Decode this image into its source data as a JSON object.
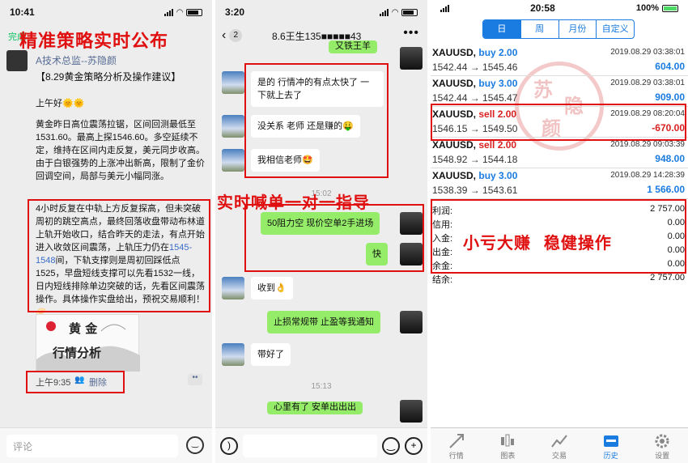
{
  "panel1": {
    "status_time": "10:41",
    "top_left": "完成",
    "overlay_title": "精准策略实时公布",
    "author": "A技术总监--苏隐颜",
    "subtitle": "【8.29黄金策略分析及操作建议】",
    "greeting": "上午好🌞🌞",
    "para1": "黄金昨日高位震荡拉锯，区间回测最低至1531.60。最高上探1546.60。多空延续不定，维持在区间内走反复，美元同步收高。由于白银强势的上涨冲出新高，限制了金价回调空间，局部与美元小幅同涨。",
    "para2_a": "4小时反复在中轨上方反复探高，但未突破周初的跳空高点，最终回落收盘带动布林道上轨开始收口，结合昨天的走法，有点开始进入收敛区间震荡，上轨压力仍在",
    "para2_range": "1545-1548",
    "para2_b": "间，下轨支撑则是周初回踩低点1525，早盘短线支撑可以先看1532一线，日内短线排除单边突破的话，先看区间震荡操作。具体操作实盘给出，预祝交易顺利！🥟",
    "poster_line1": "黄 金",
    "poster_line2": "行情分析",
    "time": "上午9:35",
    "delete": "删除",
    "comment_placeholder": "评论"
  },
  "panel2": {
    "status_time": "3:20",
    "back_count": "2",
    "chat_title": "8.6王生135■■■■■43",
    "overlay_mid": "实时喊单一对一指导",
    "messages": {
      "m0": "又铁王羊",
      "m1": "是的 行情冲的有点太快了 一下就上去了",
      "m2": "没关系 老师 还是赚的🤑",
      "m3": "我相信老师🤩",
      "ts1": "15:02",
      "m4": "50阻力空 现价空单2手进场",
      "m5": "快",
      "m6": "收到👌",
      "m7": "止损常规带 止盈等我通知",
      "m8": "带好了",
      "ts2": "15:13",
      "m9": "心里有了 安单出出出"
    }
  },
  "panel3": {
    "status_time": "20:58",
    "battery": "100%",
    "seg_tabs": [
      "日",
      "周",
      "月份",
      "自定义"
    ],
    "trades": [
      {
        "symbol": "XAUUSD,",
        "side": "buy 2.00",
        "dir": "buy",
        "date": "2019.08.29 03:38:01",
        "prices": "1542.44 → 1545.46",
        "pnl": "604.00"
      },
      {
        "symbol": "XAUUSD,",
        "side": "buy 3.00",
        "dir": "buy",
        "date": "2019.08.29 03:38:01",
        "prices": "1542.44 → 1545.47",
        "pnl": "909.00"
      },
      {
        "symbol": "XAUUSD,",
        "side": "sell 2.00",
        "dir": "sell",
        "date": "2019.08.29 08:20:04",
        "prices": "1546.15 → 1549.50",
        "pnl": "-670.00"
      },
      {
        "symbol": "XAUUSD,",
        "side": "sell 2.00",
        "dir": "sell",
        "date": "2019.08.29 09:03:39",
        "prices": "1548.92 → 1544.18",
        "pnl": "948.00"
      },
      {
        "symbol": "XAUUSD,",
        "side": "buy 3.00",
        "dir": "buy",
        "date": "2019.08.29 14:28:39",
        "prices": "1538.39 → 1543.61",
        "pnl": "1 566.00"
      }
    ],
    "summary": [
      {
        "k": "利润:",
        "v": "2 757.00"
      },
      {
        "k": "信用:",
        "v": "0.00"
      },
      {
        "k": "入金:",
        "v": "0.00"
      },
      {
        "k": "出金:",
        "v": "0.00"
      },
      {
        "k": "余金:",
        "v": "0.00"
      },
      {
        "k": "结余:",
        "v": "2 757.00"
      }
    ],
    "overlay_bottom": "小亏大赚  稳健操作",
    "stamp_chars": [
      "苏",
      "隐",
      "颜"
    ],
    "tabs": [
      "行情",
      "图表",
      "交易",
      "历史",
      "设置"
    ],
    "accent": "#1a7be0",
    "loss_color": "#d82020"
  }
}
